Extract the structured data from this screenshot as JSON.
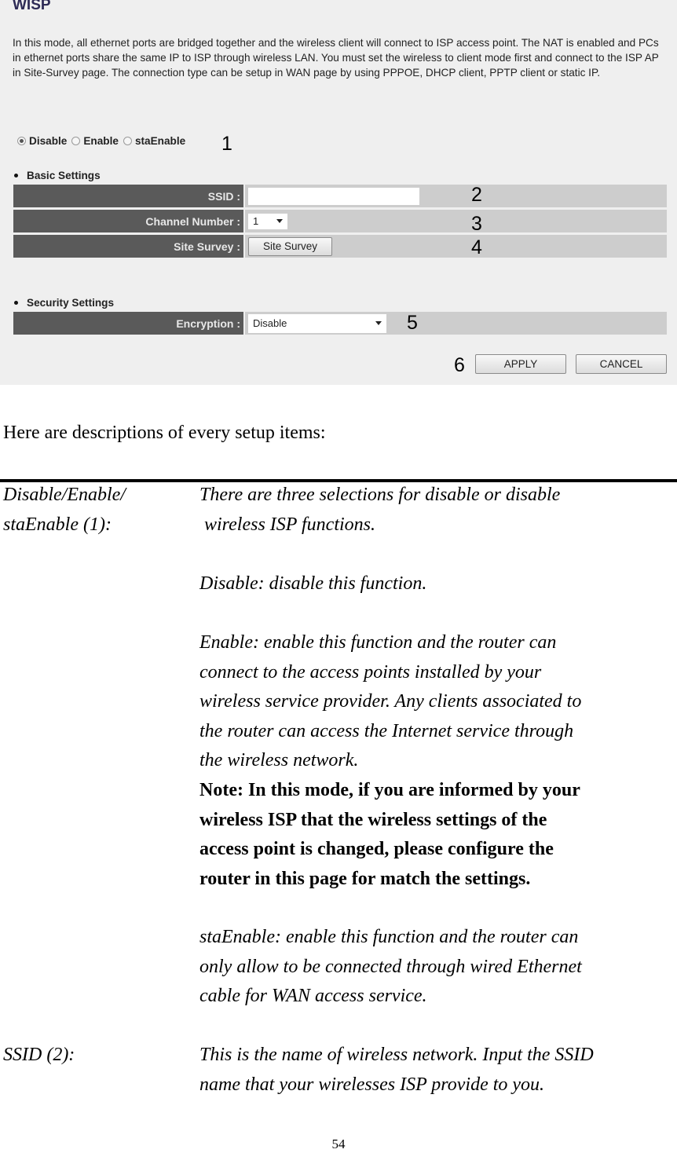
{
  "router_ui": {
    "title": "WISP",
    "intro": "In this mode, all ethernet ports are bridged together and the wireless client will connect to ISP access point. The NAT is enabled and PCs in ethernet ports share the same IP to ISP through wireless LAN. You must set the wireless to client mode first and connect to the ISP AP in Site-Survey page. The connection type can be setup in WAN page by using PPPOE, DHCP client, PPTP client or static IP.",
    "mode_options": [
      {
        "label": "Disable",
        "checked": true
      },
      {
        "label": "Enable",
        "checked": false
      },
      {
        "label": "staEnable",
        "checked": false
      }
    ],
    "basic_settings": {
      "heading": "Basic Settings",
      "ssid_label": "SSID :",
      "ssid_value": "",
      "channel_label": "Channel Number :",
      "channel_value": "1",
      "site_survey_label": "Site Survey :",
      "site_survey_button": "Site Survey"
    },
    "security_settings": {
      "heading": "Security Settings",
      "encryption_label": "Encryption :",
      "encryption_value": "Disable"
    },
    "apply_button": "APPLY",
    "cancel_button": "CANCEL",
    "callouts": [
      "1",
      "2",
      "3",
      "4",
      "5",
      "6"
    ]
  },
  "document": {
    "intro": "Here are descriptions of every setup items:",
    "items": [
      {
        "term_lines": [
          "Disable/Enable/",
          "staEnable (1):"
        ],
        "desc_lines": [
          "There are three selections for disable or disable",
          " wireless ISP functions."
        ],
        "disable_text": "Disable: disable this function.",
        "enable_lines": [
          "Enable: enable this function and the router can",
          "connect to the access points installed by your",
          "wireless service provider. Any clients associated to",
          "the router can access the Internet service through",
          "the wireless network."
        ],
        "note_lines": [
          "Note: In this mode, if you are informed by your",
          "wireless ISP that the wireless settings of the",
          "access point is changed, please configure the",
          "router in this page for match the settings."
        ],
        "staenable_lines": [
          "staEnable: enable this function and the router can",
          "only allow to be connected through wired Ethernet",
          "cable for WAN access service."
        ]
      },
      {
        "term_lines": [
          "SSID (2):"
        ],
        "desc_lines": [
          "This is the name of wireless network. Input the SSID",
          "name that your wirelesses ISP provide to you."
        ]
      }
    ],
    "page_number": "54"
  }
}
